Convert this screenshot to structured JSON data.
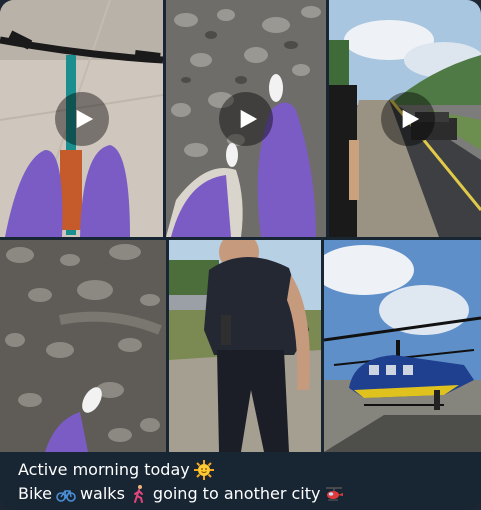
{
  "post": {
    "caption_line1_text": "Active morning today",
    "caption_line1_emoji": "sun-with-face",
    "caption_line2_part1": "Bike",
    "caption_line2_emoji1": "bicycle",
    "caption_line2_part2": "walks",
    "caption_line2_emoji2": "person-walking",
    "caption_line2_part3": "going to another city",
    "caption_line2_emoji3": "helicopter"
  },
  "media": [
    {
      "kind": "video",
      "subject": "bicycle handlebars and legs in purple leggings"
    },
    {
      "kind": "video",
      "subject": "walking on gravel in white sneakers"
    },
    {
      "kind": "video",
      "subject": "cobblestone road with passing car and guard"
    },
    {
      "kind": "photo",
      "subject": "rocky ground with one foot"
    },
    {
      "kind": "photo",
      "subject": "guard in black uniform walking"
    },
    {
      "kind": "photo",
      "subject": "blue and yellow helicopter on tarmac"
    }
  ],
  "colors": {
    "bubble": "#182533",
    "caption_text": "#ffffff",
    "play_overlay": "rgba(0,0,0,0.42)"
  }
}
